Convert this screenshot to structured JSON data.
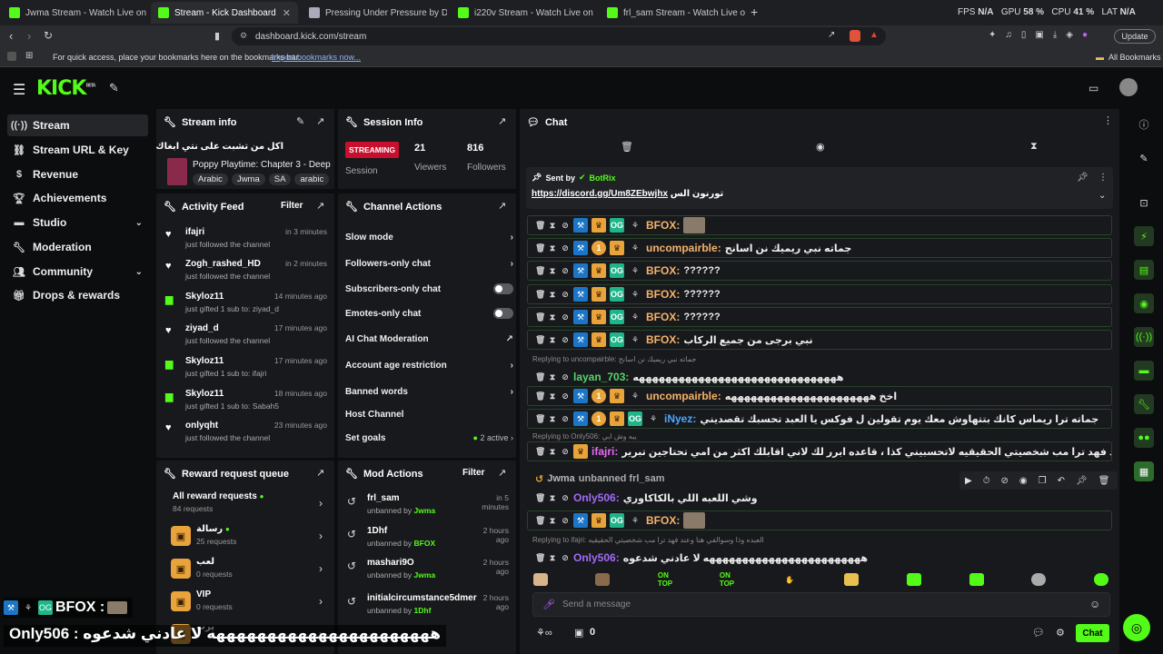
{
  "browser": {
    "tabs": [
      {
        "title": "Jwma Stream - Watch Live on Kick",
        "active": false
      },
      {
        "title": "Stream - Kick Dashboard",
        "active": true
      },
      {
        "title": "Pressing Under Pressure by Donitz",
        "active": false
      },
      {
        "title": "i220v Stream - Watch Live on Kick",
        "active": false
      },
      {
        "title": "frl_sam Stream - Watch Live on Kick",
        "active": false
      }
    ],
    "new_tab": "+",
    "perf": {
      "fps_label": "FPS",
      "fps": "N/A",
      "gpu_label": "GPU",
      "gpu": "58 %",
      "cpu_label": "CPU",
      "cpu": "41 %",
      "lat_label": "LAT",
      "lat": "N/A"
    },
    "url": "dashboard.kick.com/stream",
    "update_label": "Update",
    "bookmarks_hint": "For quick access, place your bookmarks here on the bookmarks bar.",
    "import_link": "Import bookmarks now...",
    "all_bookmarks": "All Bookmarks"
  },
  "header": {
    "logo": "KICK",
    "logo_sup": "BETA"
  },
  "sidebar": {
    "items": [
      {
        "label": "Stream",
        "icon": "stream-icon"
      },
      {
        "label": "Stream URL & Key",
        "icon": "link-icon"
      },
      {
        "label": "Revenue",
        "icon": "dollar-icon"
      },
      {
        "label": "Achievements",
        "icon": "trophy-icon"
      },
      {
        "label": "Studio",
        "icon": "studio-icon"
      },
      {
        "label": "Moderation",
        "icon": "wrench-icon"
      },
      {
        "label": "Community",
        "icon": "people-icon"
      },
      {
        "label": "Drops & rewards",
        "icon": "gift-icon"
      }
    ]
  },
  "stream_info": {
    "title": "Stream info",
    "stream_title": "اكل من تشبت على نتي ابغاك بكلمة راس",
    "category": "Poppy Playtime: Chapter 3 - Deep",
    "tags": [
      "Arabic",
      "Jwma",
      "SA",
      "arabic"
    ]
  },
  "session_info": {
    "title": "Session Info",
    "status": "STREAMING",
    "status_label": "Session",
    "viewers": "21",
    "viewers_label": "Viewers",
    "followers": "816",
    "followers_label": "Followers"
  },
  "activity_feed": {
    "title": "Activity Feed",
    "filter": "Filter",
    "items": [
      {
        "name": "ifajri",
        "time": "in 3 minutes",
        "sub": "just followed the channel",
        "icon": "heart-icon"
      },
      {
        "name": "Zogh_rashed_HD",
        "time": "in 2 minutes",
        "sub": "just followed the channel",
        "icon": "heart-icon"
      },
      {
        "name": "Skyloz11",
        "time": "14 minutes ago",
        "sub": "just gifted 1 sub to: ziyad_d",
        "icon": "gift-icon"
      },
      {
        "name": "ziyad_d",
        "time": "17 minutes ago",
        "sub": "just followed the channel",
        "icon": "heart-icon"
      },
      {
        "name": "Skyloz11",
        "time": "17 minutes ago",
        "sub": "just gifted 1 sub to: ifajri",
        "icon": "gift-icon"
      },
      {
        "name": "Skyloz11",
        "time": "18 minutes ago",
        "sub": "just gifted 1 sub to: Sabah5",
        "icon": "gift-icon"
      },
      {
        "name": "onlyqht",
        "time": "23 minutes ago",
        "sub": "just followed the channel",
        "icon": "heart-icon"
      }
    ]
  },
  "channel_actions": {
    "title": "Channel Actions",
    "items": [
      {
        "label": "Slow mode",
        "right": "›"
      },
      {
        "label": "Followers-only chat",
        "right": "›"
      },
      {
        "label": "Subscribers-only chat",
        "right": "toggle"
      },
      {
        "label": "Emotes-only chat",
        "right": "toggle"
      },
      {
        "label": "AI Chat Moderation",
        "right": "↗"
      },
      {
        "label": "Account age restriction",
        "right": "›"
      },
      {
        "label": "Banned words",
        "right": "›"
      },
      {
        "label": "Host Channel",
        "right": ""
      },
      {
        "label": "Set goals",
        "right": "2 active ›"
      }
    ]
  },
  "reward_queue": {
    "title": "Reward request queue",
    "items": [
      {
        "name": "All reward requests",
        "sub": "84 requests"
      },
      {
        "name": "رسالة",
        "sub": "25 requests"
      },
      {
        "name": "لعب",
        "sub": "0 requests"
      },
      {
        "name": "VIP",
        "sub": "0 requests"
      },
      {
        "name": "يرب",
        "sub": ""
      }
    ]
  },
  "mod_actions": {
    "title": "Mod Actions",
    "filter": "Filter",
    "items": [
      {
        "name": "frl_sam",
        "sub": "unbanned by ",
        "by": "Jwma",
        "time": "in 5 minutes"
      },
      {
        "name": "1Dhf",
        "sub": "unbanned by ",
        "by": "BFOX",
        "time": "2 hours ago"
      },
      {
        "name": "mashari9O",
        "sub": "unbanned by ",
        "by": "Jwma",
        "time": "2 hours ago"
      },
      {
        "name": "initialcircumstance5dmer",
        "sub": "unbanned by ",
        "by": "1Dhf",
        "time": "2 hours ago"
      }
    ]
  },
  "chat": {
    "title": "Chat",
    "pinned": {
      "sent_by": "Sent by",
      "bot": "BotRix",
      "link": "https://discord.gg/Um8ZEbwjhx",
      "link_text": "تورنون الس"
    },
    "messages": [
      {
        "user": "BFOX",
        "color": "#f5b36a",
        "text": ""
      },
      {
        "user": "uncompairble",
        "color": "#f5b36a",
        "text": "جماته نبي ريميك نن اسانح"
      },
      {
        "user": "BFOX",
        "color": "#f5b36a",
        "text": "??????"
      },
      {
        "user": "BFOX",
        "color": "#f5b36a",
        "text": "??????"
      },
      {
        "user": "BFOX",
        "color": "#f5b36a",
        "text": "??????"
      },
      {
        "user": "BFOX",
        "color": "#f5b36a",
        "text": "نبي برجى من جميع الركاب"
      },
      {
        "user": "layan_703",
        "color": "#55d46a",
        "text": "هههههههههههههههههههههههههههههههه",
        "reply": "Replying to uncompairble: جماته نبي ريميك نن اسانح"
      },
      {
        "user": "uncompairble",
        "color": "#f5b36a",
        "text": "اخخ ههههههههههههههههههههههه"
      },
      {
        "user": "iNyez",
        "color": "#4aa8ff",
        "text": "جماته ترا ريماس كانك بتتهاوش معك يوم تقولين ل فوكس يا العبد تحسبك تقصديني"
      },
      {
        "user": "ifajri",
        "color": "#e86bf5",
        "text": "العبده وذا وسوالفي هنا وعند فهد ترا مب شخصيتي الحقيقيه لاتحسبيني كذا ، قاعده ابرر لك لاني اقابلك اكثر من امي تحتاجين تبرير",
        "reply": "Replying to Only506: يبه وش ابي"
      },
      {
        "user": "Jwma",
        "color": "#b8b8b8",
        "text": "unbanned frl_sam",
        "system": true
      },
      {
        "user": "Only506",
        "color": "#a06bf5",
        "text": "وشي اللعبه اللي بالكاكاوري"
      },
      {
        "user": "BFOX",
        "color": "#f5b36a",
        "text": ""
      },
      {
        "user": "Only506",
        "color": "#a06bf5",
        "text": "ههههههههههههههههههههههههه لا عادني شدعوه",
        "reply": "Replying to ifajri: العبده وذا وسوالفي هنا وعند فهد ترا مب شخصيتي الحقيقيه"
      }
    ],
    "input_placeholder": "Send a message",
    "points": "0",
    "send_label": "Chat"
  },
  "overlay": {
    "line1_user": "BFOX :",
    "line2": "Only506 : ههههههههههههههههههههههه لا عادني شدعوه"
  },
  "colors": {
    "kick_green": "#53fc18",
    "panel": "#18191c",
    "bg": "#0b0d0e"
  }
}
